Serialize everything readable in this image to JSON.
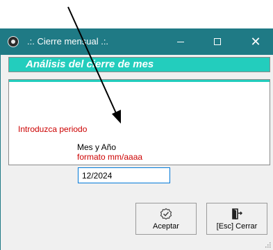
{
  "window": {
    "title": ".:. Cierre mensual .:.",
    "header": "Análisis del cierre de mes",
    "controls": {
      "minimize": "—",
      "maximize": "□",
      "close": "✕"
    }
  },
  "form": {
    "period_label": "Introduzca periodo",
    "month_year_label": "Mes y Año",
    "format_hint": "formato mm/aaaa",
    "date_value": "12/2024"
  },
  "buttons": {
    "accept_label": "Aceptar",
    "close_label": "[Esc] Cerrar"
  },
  "colors": {
    "titlebar": "#1f7a85",
    "header_bar": "#23cdbd",
    "label_red": "#cc0000",
    "input_border": "#0078d7"
  },
  "icons": {
    "app": "eye-icon",
    "accept": "check-badge-icon",
    "close": "exit-door-icon"
  }
}
